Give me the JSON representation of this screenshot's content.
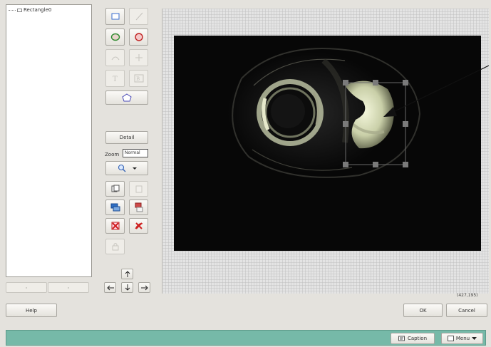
{
  "tree": {
    "items": [
      "Rectangle0"
    ]
  },
  "toolbar": {
    "detail_label": "Detail",
    "zoom_label": "Zoom",
    "zoom_value": "Normal"
  },
  "bottom": {
    "help_label": "Help",
    "ok_label": "OK",
    "cancel_label": "Cancel",
    "coordinates": "(427,195)"
  },
  "statusbar": {
    "caption_label": "Caption",
    "menu_label": "Menu"
  },
  "colors": {
    "statusbar": "#76b9a8",
    "image_background": "#070707",
    "selection_handle": "#7a7a7a"
  },
  "icons": {
    "tools": [
      "rectangle-icon",
      "line-icon",
      "ellipse-icon",
      "circle-icon",
      "arc-icon",
      "cross-icon",
      "text-icon",
      "text-box-icon",
      "polygon-icon"
    ],
    "edit": [
      "copy-icon",
      "paste-icon",
      "color-fill-icon",
      "paint-icon",
      "delete-icon",
      "delete-all-icon",
      "lock-icon"
    ],
    "nav": [
      "arrow-up-icon",
      "arrow-left-icon",
      "arrow-down-icon",
      "arrow-right-icon"
    ]
  }
}
